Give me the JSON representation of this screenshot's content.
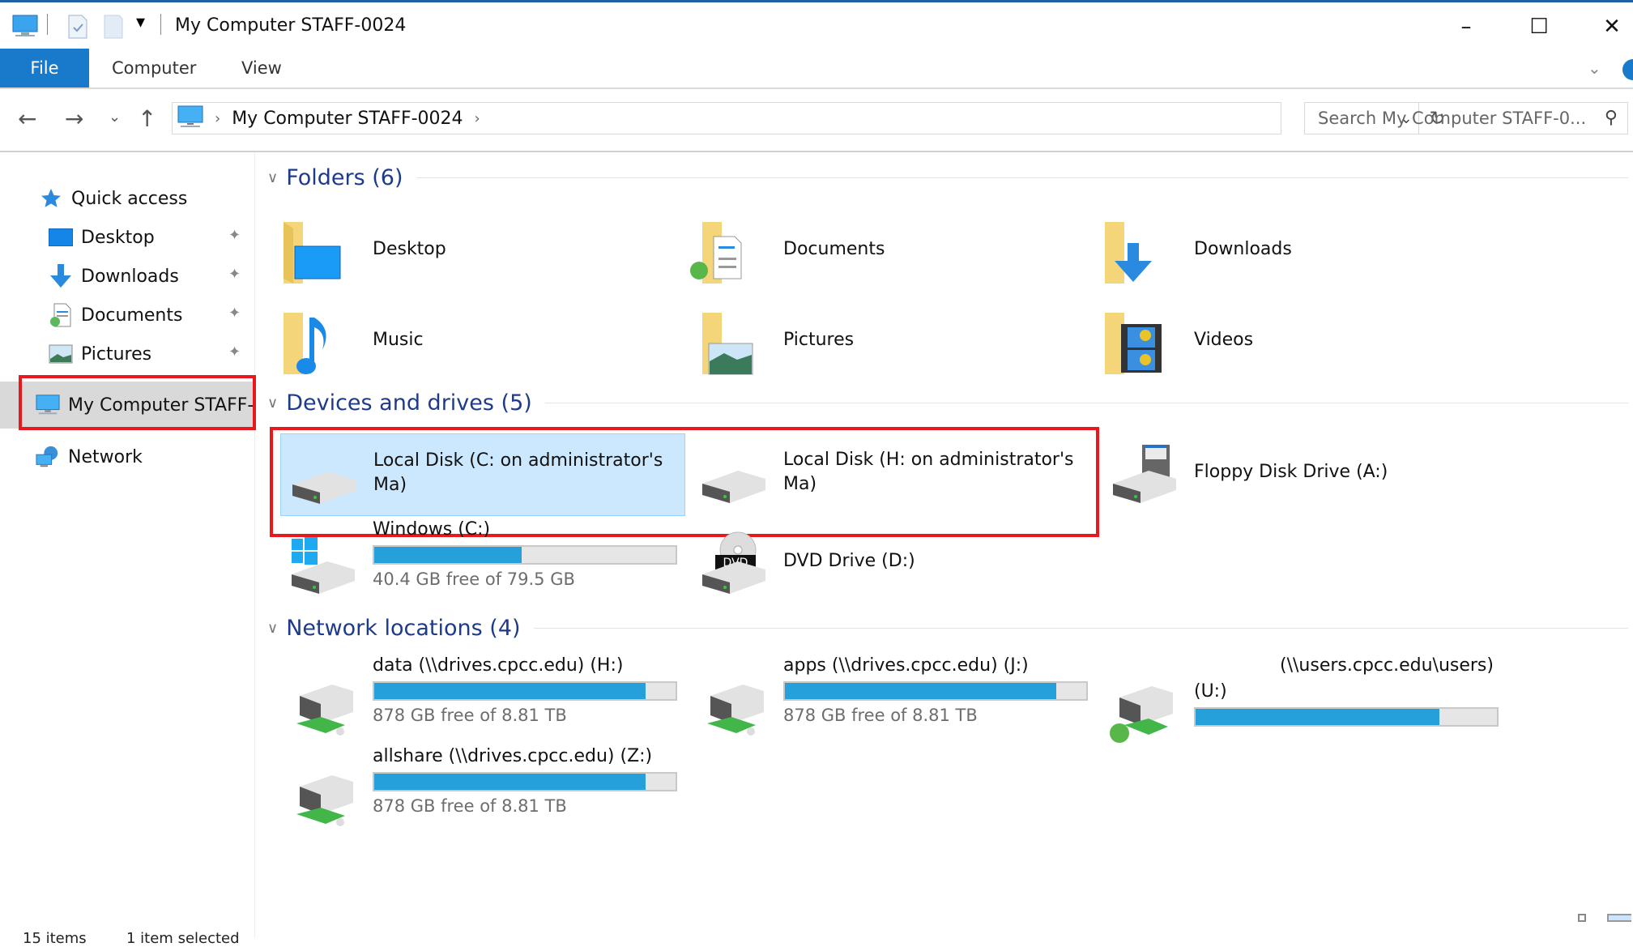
{
  "window": {
    "title": "My Computer STAFF-0024",
    "controls": {
      "minimize": "–",
      "maximize": "☐",
      "close": "✕"
    }
  },
  "quick_access_toolbar": {
    "icons": [
      "computer-icon",
      "properties-icon",
      "new-folder-icon",
      "customize-toolbar-icon"
    ],
    "customize_glyph": "▾"
  },
  "ribbon": {
    "tabs": [
      {
        "label": "File",
        "active": true
      },
      {
        "label": "Computer"
      },
      {
        "label": "View"
      }
    ],
    "expand_glyph": "⌄",
    "accent": "#1979ca"
  },
  "navigation": {
    "back": "←",
    "forward": "→",
    "recent": "⌄",
    "up": "↑",
    "breadcrumb": [
      "My Computer STAFF-0024"
    ],
    "separator": "›",
    "dropdown": "⌄",
    "refresh": "↻",
    "search_placeholder": "Search My Computer STAFF-0...",
    "search_glyph": "⚲"
  },
  "sidebar": {
    "quick_access": {
      "label": "Quick access",
      "icon": "star-icon"
    },
    "pinned": [
      {
        "label": "Desktop",
        "icon": "desktop-icon",
        "pinned": true
      },
      {
        "label": "Downloads",
        "icon": "downloads-icon",
        "pinned": true
      },
      {
        "label": "Documents",
        "icon": "documents-icon",
        "pinned": true
      },
      {
        "label": "Pictures",
        "icon": "pictures-icon",
        "pinned": true
      }
    ],
    "this_pc": {
      "label": "My Computer STAFF-",
      "icon": "computer-icon",
      "selected": true
    },
    "network": {
      "label": "Network",
      "icon": "network-icon"
    },
    "pin_glyph": "📌"
  },
  "groups": {
    "folders": {
      "header": "Folders (6)",
      "items": [
        {
          "name": "Desktop",
          "icon": "desktop-folder-icon"
        },
        {
          "name": "Documents",
          "icon": "documents-folder-icon"
        },
        {
          "name": "Downloads",
          "icon": "downloads-folder-icon"
        },
        {
          "name": "Music",
          "icon": "music-folder-icon"
        },
        {
          "name": "Pictures",
          "icon": "pictures-folder-icon"
        },
        {
          "name": "Videos",
          "icon": "videos-folder-icon"
        }
      ]
    },
    "devices": {
      "header": "Devices and drives (5)",
      "items": [
        {
          "name_line1": "Local Disk (C: on administrator's",
          "name_line2": "Ma)",
          "icon": "hard-drive-icon",
          "selected": true
        },
        {
          "name_line1": "Local Disk (H: on administrator's",
          "name_line2": "Ma)",
          "icon": "hard-drive-icon"
        },
        {
          "name": "Floppy Disk Drive (A:)",
          "icon": "floppy-drive-icon"
        },
        {
          "name": "Windows (C:)",
          "icon": "windows-drive-icon",
          "used_fraction": 0.49,
          "free_text": "40.4 GB free of 79.5 GB"
        },
        {
          "name": "DVD Drive (D:)",
          "icon": "dvd-drive-icon",
          "badge": "DVD"
        }
      ]
    },
    "network": {
      "header": "Network locations (4)",
      "items": [
        {
          "name": "data (\\\\drives.cpcc.edu) (H:)",
          "icon": "network-drive-icon",
          "used_fraction": 0.9,
          "free_text": "878 GB free of 8.81 TB"
        },
        {
          "name": "apps (\\\\drives.cpcc.edu) (J:)",
          "icon": "network-drive-icon",
          "used_fraction": 0.9,
          "free_text": "878 GB free of 8.81 TB"
        },
        {
          "name_line1": "(\\\\users.cpcc.edu\\users)",
          "name_line2": "(U:)",
          "icon": "network-drive-sync-icon",
          "used_fraction": 0.81
        },
        {
          "name": "allshare (\\\\drives.cpcc.edu) (Z:)",
          "icon": "network-drive-icon",
          "used_fraction": 0.9,
          "free_text": "878 GB free of 8.81 TB"
        }
      ]
    }
  },
  "status": {
    "items": "15 items",
    "selected": "1 item selected"
  }
}
